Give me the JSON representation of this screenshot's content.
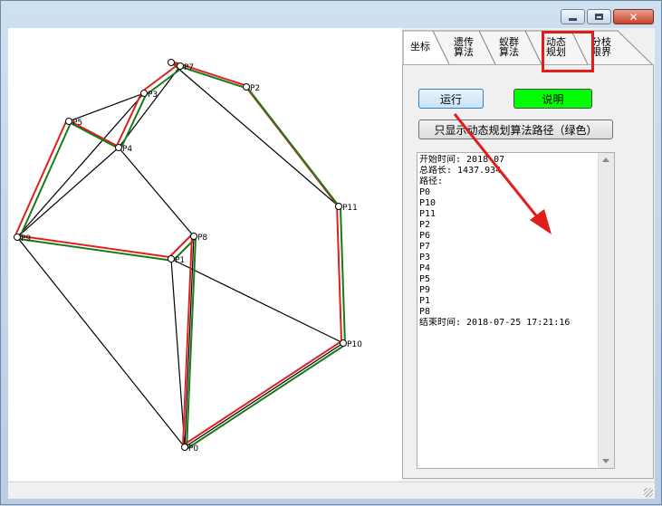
{
  "window": {
    "controls": {
      "minimize": "minimize-icon",
      "maximize": "maximize-icon",
      "close": "close-icon"
    }
  },
  "canvas": {
    "points": [
      {
        "id": "P0",
        "label": "P0"
      },
      {
        "id": "P10",
        "label": "P10"
      },
      {
        "id": "P11",
        "label": "P11"
      },
      {
        "id": "P2",
        "label": "P2"
      },
      {
        "id": "P6",
        "label": ""
      },
      {
        "id": "P7",
        "label": "P7"
      },
      {
        "id": "P3",
        "label": "P3"
      },
      {
        "id": "P4",
        "label": "P4"
      },
      {
        "id": "P5",
        "label": "P5"
      },
      {
        "id": "P9",
        "label": "P9"
      },
      {
        "id": "P1",
        "label": "P1"
      },
      {
        "id": "P8",
        "label": "P8"
      }
    ],
    "path_colors": {
      "genetic": "#e0201e",
      "dynamic": "#1a7a1a",
      "edges": "#000000"
    }
  },
  "tabs": [
    {
      "label_line1": "坐标",
      "label_line2": ""
    },
    {
      "label_line1": "遗传",
      "label_line2": "算法"
    },
    {
      "label_line1": "蚁群",
      "label_line2": "算法"
    },
    {
      "label_line1": "动态",
      "label_line2": "规划"
    },
    {
      "label_line1": "分枝",
      "label_line2": "限界"
    }
  ],
  "buttons": {
    "run": "运行",
    "info": "说明",
    "only_dynamic": "只显示动态规划算法路径（绿色）"
  },
  "log": [
    "开始时间: 2018-07",
    "总路长: 1437.934",
    "路径:",
    "P0",
    "P10",
    "P11",
    "P2",
    "P6",
    "P7",
    "P3",
    "P4",
    "P5",
    "P9",
    "P1",
    "P8",
    "结束时间: 2018-07-25 17:21:16"
  ],
  "colors": {
    "info_button": "#00ff00",
    "annotation": "#e21b1b"
  }
}
